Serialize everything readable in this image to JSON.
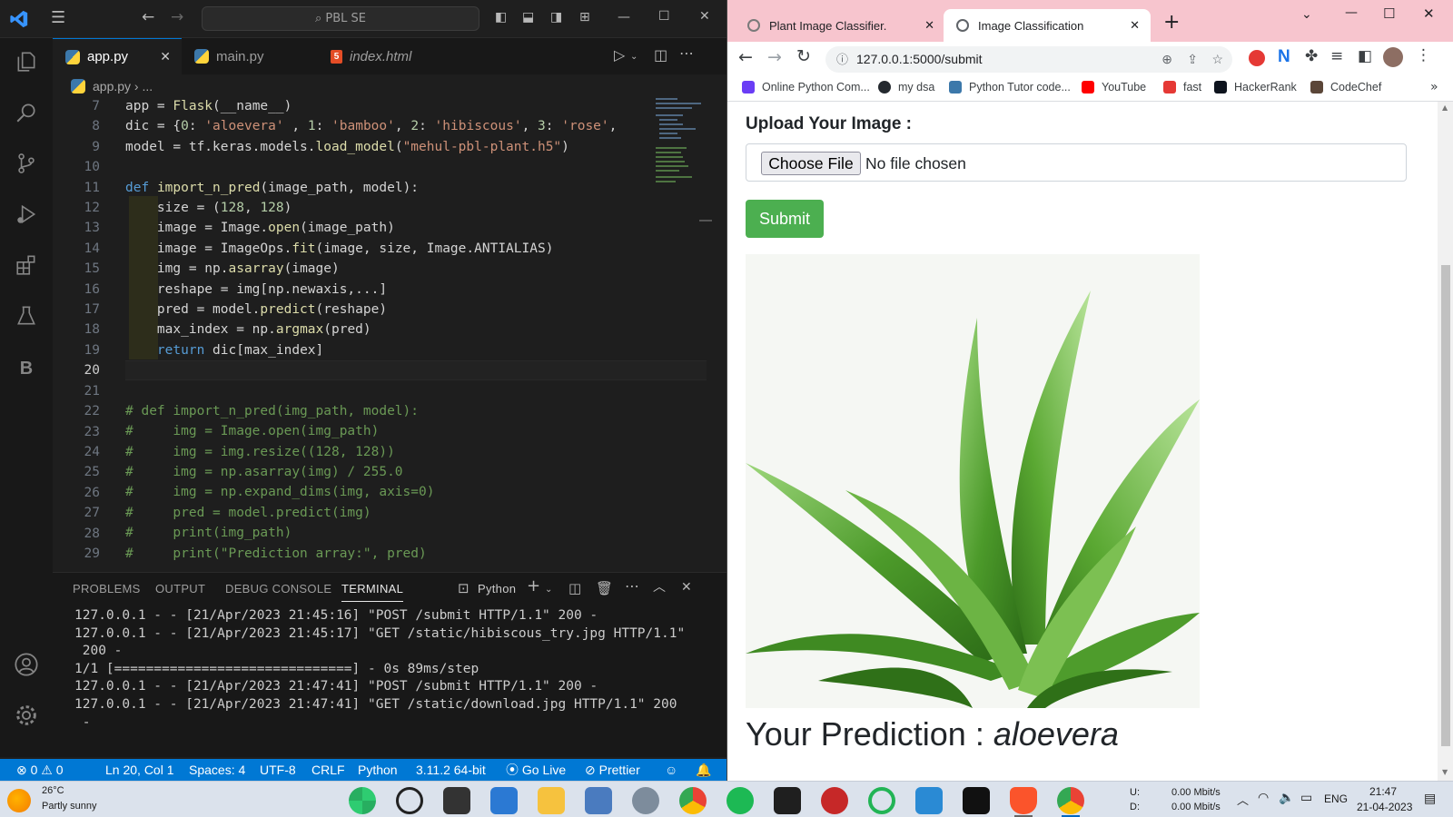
{
  "vscode": {
    "command_center": "PBL SE",
    "tabs": [
      {
        "label": "app.py",
        "close": "✕"
      },
      {
        "label": "main.py"
      },
      {
        "label": "index.html"
      }
    ],
    "breadcrumb": "app.py › ...",
    "line_numbers": [
      "7",
      "8",
      "9",
      "10",
      "11",
      "12",
      "13",
      "14",
      "15",
      "16",
      "17",
      "18",
      "19",
      "20",
      "21",
      "22",
      "23",
      "24",
      "25",
      "26",
      "27",
      "28",
      "29"
    ],
    "code_lines": [
      "app = Flask(__name__)",
      "dic = {0: 'aloevera' , 1: 'bamboo', 2: 'hibiscous', 3: 'rose',",
      "model = tf.keras.models.load_model(\"mehul-pbl-plant.h5\")",
      "",
      "def import_n_pred(image_path, model):",
      "    size = (128, 128)",
      "    image = Image.open(image_path)",
      "    image = ImageOps.fit(image, size, Image.ANTIALIAS)",
      "    img = np.asarray(image)",
      "    reshape = img[np.newaxis,...]",
      "    pred = model.predict(reshape)",
      "    max_index = np.argmax(pred)",
      "    return dic[max_index]",
      "",
      "",
      "# def import_n_pred(img_path, model):",
      "#     img = Image.open(img_path)",
      "#     img = img.resize((128, 128))",
      "#     img = np.asarray(img) / 255.0",
      "#     img = np.expand_dims(img, axis=0)",
      "#     pred = model.predict(img)",
      "#     print(img_path)",
      "#     print(\"Prediction array:\", pred)"
    ],
    "panel_tabs": [
      "PROBLEMS",
      "OUTPUT",
      "DEBUG CONSOLE",
      "TERMINAL"
    ],
    "terminal_profile": "Python",
    "terminal_lines": [
      "127.0.0.1 - - [21/Apr/2023 21:45:16] \"POST /submit HTTP/1.1\" 200 -",
      "127.0.0.1 - - [21/Apr/2023 21:45:17] \"GET /static/hibiscous_try.jpg HTTP/1.1\"",
      " 200 -",
      "1/1 [==============================] - 0s 89ms/step",
      "127.0.0.1 - - [21/Apr/2023 21:47:41] \"POST /submit HTTP/1.1\" 200 -",
      "127.0.0.1 - - [21/Apr/2023 21:47:41] \"GET /static/download.jpg HTTP/1.1\" 200",
      " -"
    ],
    "status": {
      "errors": "⊗ 0 ⚠ 0",
      "position": "Ln 20, Col 1",
      "spaces": "Spaces: 4",
      "encoding": "UTF-8",
      "eol": "CRLF",
      "language": "Python",
      "interpreter": "3.11.2 64-bit",
      "golive": "Go Live",
      "prettier": "Prettier"
    }
  },
  "browser": {
    "tabs": [
      {
        "label": "Plant Image Classifier."
      },
      {
        "label": "Image Classification"
      }
    ],
    "url": "127.0.0.1:5000/submit",
    "bookmarks": [
      {
        "label": "Online Python Com...",
        "color": "#6a3df5"
      },
      {
        "label": "my dsa",
        "color": "#24292f"
      },
      {
        "label": "Python Tutor code...",
        "color": "#3c78aa"
      },
      {
        "label": "YouTube",
        "color": "#ff0000"
      },
      {
        "label": "fast",
        "color": "#e53935"
      },
      {
        "label": "HackerRank",
        "color": "#0e141e"
      },
      {
        "label": "CodeChef",
        "color": "#5b4638"
      }
    ],
    "page": {
      "upload_label": "Upload Your Image :",
      "choose_file": "Choose File",
      "no_file": "No file chosen",
      "submit": "Submit",
      "prediction_prefix": "Your Prediction : ",
      "prediction_value": "aloevera"
    }
  },
  "taskbar": {
    "temp": "26°C",
    "weather": "Partly sunny",
    "net_up": "U:",
    "net_down": "D:",
    "net_up_val": "0.00 Mbit/s",
    "net_down_val": "0.00 Mbit/s",
    "lang": "ENG",
    "time": "21:47",
    "date": "21-04-2023"
  }
}
